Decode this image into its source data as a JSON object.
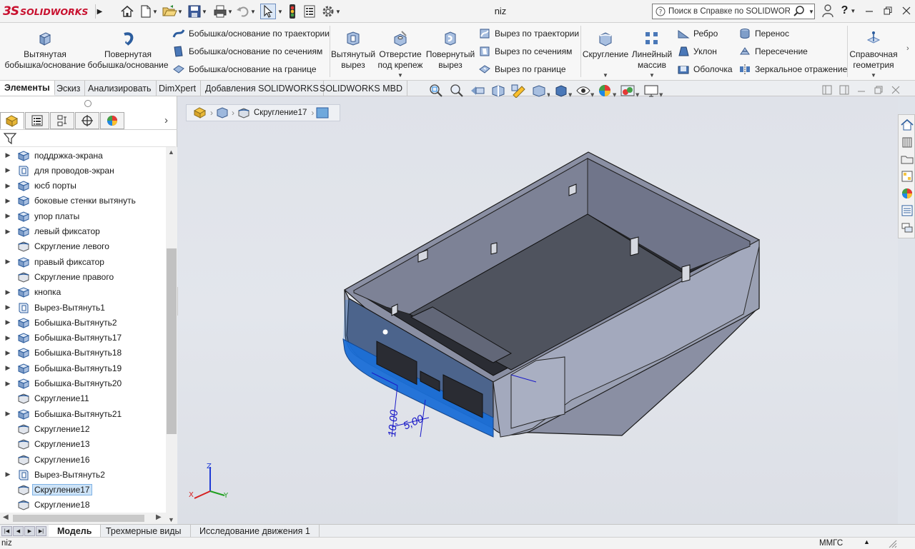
{
  "app": {
    "brand_ds": "3S",
    "brand_name": "SOLIDWORKS",
    "doc_title": "niz"
  },
  "search": {
    "placeholder": "Поиск в Справке по SOLIDWORKS"
  },
  "icons": [
    "home-icon",
    "new-document-icon",
    "open-icon",
    "save-icon",
    "print-icon",
    "undo-icon",
    "select-icon",
    "traffic-light-icon",
    "options-icon",
    "gear-icon",
    "user-icon",
    "help-icon",
    "minimize-icon",
    "restore-icon",
    "close-icon"
  ],
  "help_label": "?",
  "features": {
    "extrude_boss": "Вытянутая бобышка/основание",
    "revolve_boss": "Повернутая бобышка/основание",
    "sweep_boss": "Бобышка/основание по траектории",
    "loft_boss": "Бобышка/основание по сечениям",
    "boundary_boss": "Бобышка/основание на границе",
    "extrude_cut": "Вытянутый вырез",
    "hole_wizard": "Отверстие под крепеж",
    "revolve_cut": "Повернутый вырез",
    "sweep_cut": "Вырез по траектории",
    "loft_cut": "Вырез по сечениям",
    "boundary_cut": "Вырез по границе",
    "fillet": "Скругление",
    "linear_pattern": "Линейный массив",
    "rib": "Ребро",
    "draft": "Уклон",
    "shell": "Оболочка",
    "wrap": "Перенос",
    "intersect": "Пересечение",
    "mirror": "Зеркальное отражение",
    "ref_geometry": "Справочная геометрия"
  },
  "cmd_tabs": [
    "Элементы",
    "Эскиз",
    "Анализировать",
    "DimXpert",
    "Добавления SOLIDWORKS",
    "SOLIDWORKS MBD"
  ],
  "tree": {
    "items": [
      {
        "label": "поддржка-экрана",
        "expandable": true,
        "icon": "extrude"
      },
      {
        "label": "для проводов-экран",
        "expandable": true,
        "icon": "cut"
      },
      {
        "label": "юсб порты",
        "expandable": true,
        "icon": "extrude"
      },
      {
        "label": "боковые стенки вытянуть",
        "expandable": true,
        "icon": "extrude"
      },
      {
        "label": "упор платы",
        "expandable": true,
        "icon": "extrude"
      },
      {
        "label": "левый фиксатор",
        "expandable": true,
        "icon": "extrude"
      },
      {
        "label": "Скругление левого",
        "expandable": false,
        "icon": "fillet"
      },
      {
        "label": "правый фиксатор",
        "expandable": true,
        "icon": "extrude"
      },
      {
        "label": "Скругление правого",
        "expandable": false,
        "icon": "fillet"
      },
      {
        "label": "кнопка",
        "expandable": true,
        "icon": "extrude"
      },
      {
        "label": "Вырез-Вытянуть1",
        "expandable": true,
        "icon": "cut"
      },
      {
        "label": "Бобышка-Вытянуть2",
        "expandable": true,
        "icon": "extrude"
      },
      {
        "label": "Бобышка-Вытянуть17",
        "expandable": true,
        "icon": "extrude"
      },
      {
        "label": "Бобышка-Вытянуть18",
        "expandable": true,
        "icon": "extrude"
      },
      {
        "label": "Бобышка-Вытянуть19",
        "expandable": true,
        "icon": "extrude"
      },
      {
        "label": "Бобышка-Вытянуть20",
        "expandable": true,
        "icon": "extrude"
      },
      {
        "label": "Скругление11",
        "expandable": false,
        "icon": "fillet"
      },
      {
        "label": "Бобышка-Вытянуть21",
        "expandable": true,
        "icon": "extrude"
      },
      {
        "label": "Скругление12",
        "expandable": false,
        "icon": "fillet"
      },
      {
        "label": "Скругление13",
        "expandable": false,
        "icon": "fillet"
      },
      {
        "label": "Скругление16",
        "expandable": false,
        "icon": "fillet"
      },
      {
        "label": "Вырез-Вытянуть2",
        "expandable": true,
        "icon": "cut"
      },
      {
        "label": "Скругление17",
        "expandable": false,
        "icon": "fillet",
        "selected": true
      },
      {
        "label": "Скругление18",
        "expandable": false,
        "icon": "fillet"
      }
    ]
  },
  "breadcrumb": {
    "current": "Скругление17"
  },
  "dimensions": {
    "d1": "10,00",
    "d2": "5,00"
  },
  "triad": {
    "x": "X",
    "y": "Y",
    "z": "Z"
  },
  "bottom_tabs": [
    "Модель",
    "Трехмерные виды",
    "Исследование движения 1"
  ],
  "status": {
    "doc": "niz",
    "units": "ММГС"
  },
  "colors": {
    "accent": "#0078d7",
    "selection": "#1b6fd8",
    "model_body": "#8a8fa3",
    "brand": "#c8102e"
  }
}
